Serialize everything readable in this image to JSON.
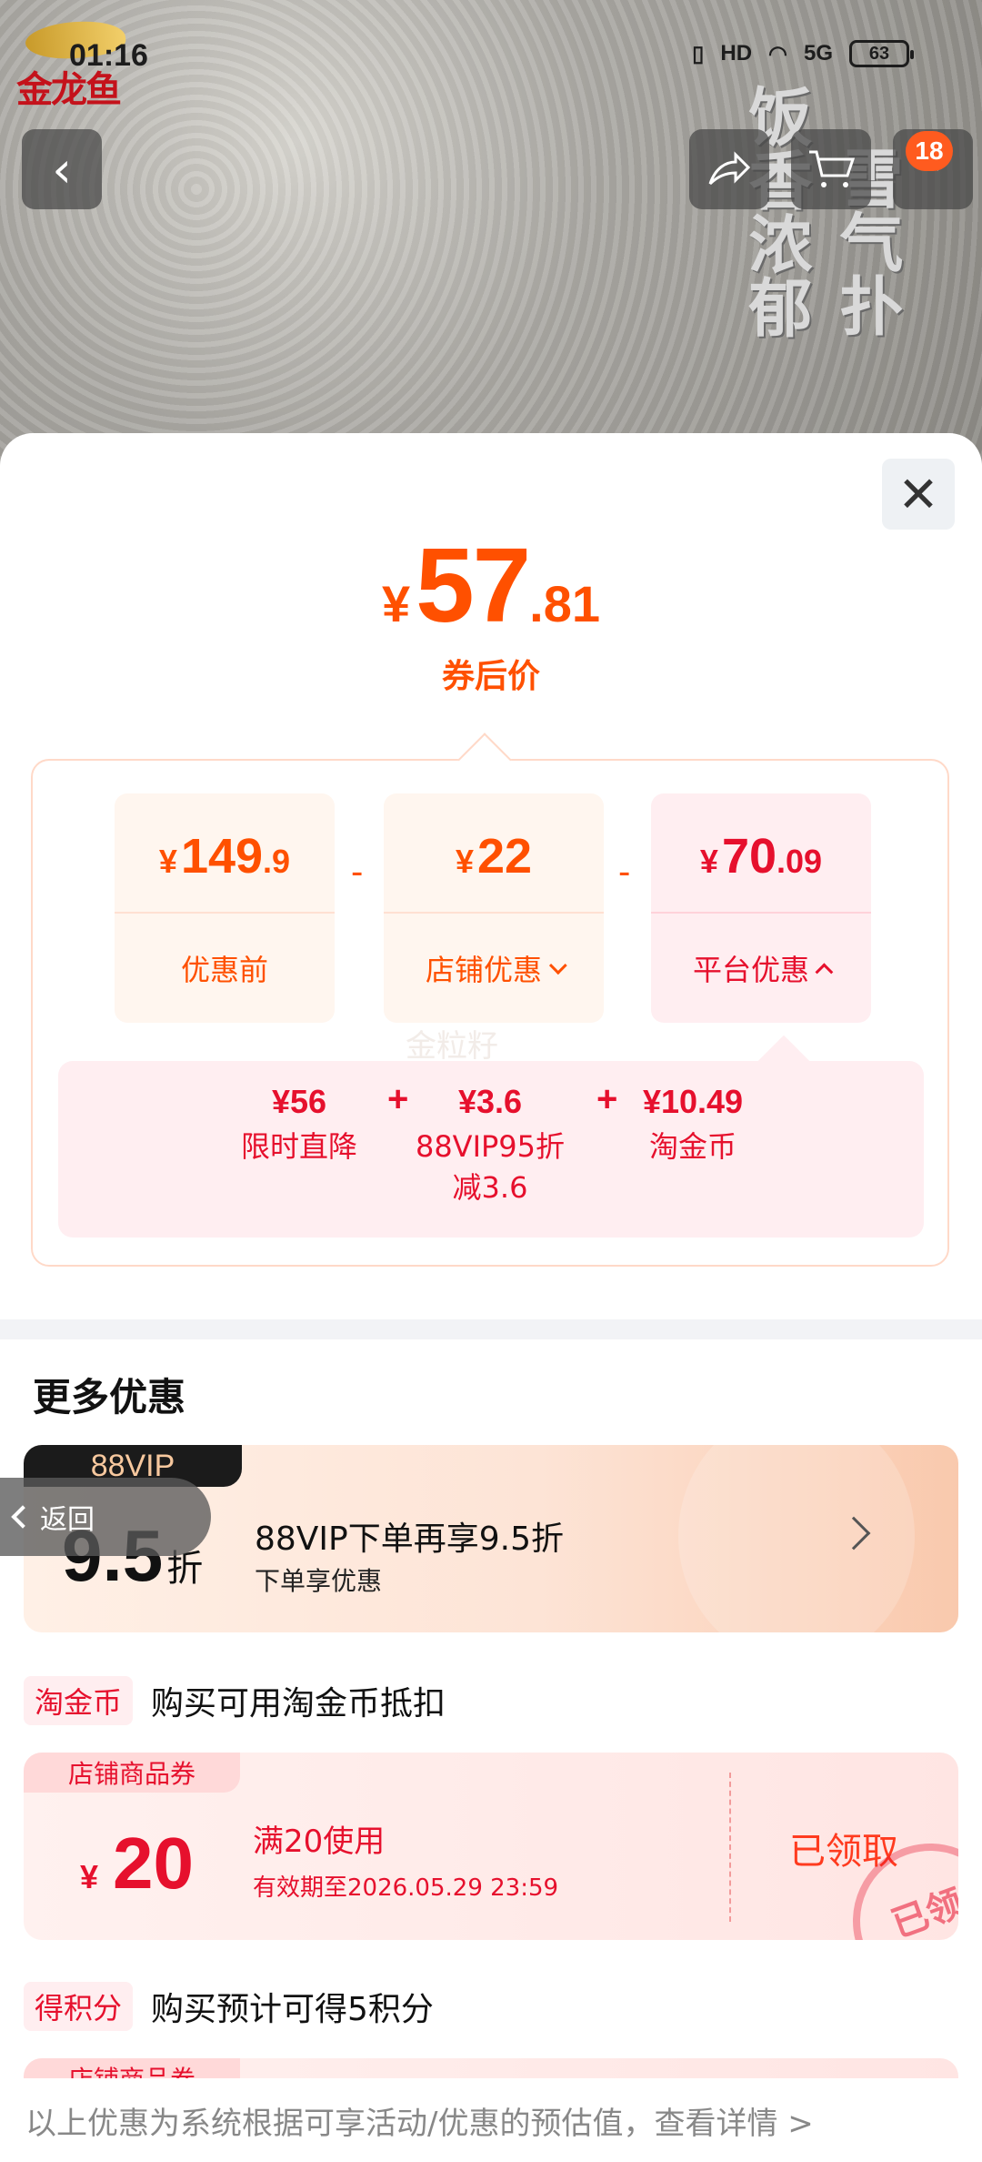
{
  "status_bar": {
    "time": "01:16",
    "hd": "HD",
    "network": "5G",
    "battery": "63"
  },
  "brand": {
    "name": "金龙鱼"
  },
  "background_slogans": {
    "left": "饭香浓郁",
    "right": "雪气扑"
  },
  "header": {
    "cart_badge": "18"
  },
  "sheet": {
    "final_price": {
      "currency": "¥",
      "integer": "57",
      "decimal": ".81",
      "label": "券后价"
    },
    "breakdown": [
      {
        "currency": "¥",
        "integer": "149",
        "decimal": ".9",
        "label": "优惠前"
      },
      {
        "currency": "¥",
        "integer": "22",
        "decimal": "",
        "label": "店铺优惠"
      },
      {
        "currency": "¥",
        "integer": "70",
        "decimal": ".09",
        "label": "平台优惠"
      }
    ],
    "operators": [
      "-",
      "-"
    ],
    "watermark": "金粒籽",
    "platform_details": [
      {
        "value": "¥56",
        "label": "限时直降"
      },
      {
        "value": "¥3.6",
        "label": "88VIP95折减3.6"
      },
      {
        "value": "¥10.49",
        "label": "淘金币"
      }
    ],
    "plus_ops": [
      "+",
      "+"
    ],
    "more_title": "更多优惠",
    "vip": {
      "tag": "88VIP",
      "discount_num": "9.5",
      "discount_unit": "折",
      "title": "88VIP下单再享9.5折",
      "subtitle": "下单享优惠"
    },
    "back_button": "返回",
    "coin_row": {
      "tag": "淘金币",
      "text": "购买可用淘金币抵扣"
    },
    "coupon": {
      "tag": "店铺商品券",
      "currency": "¥",
      "amount": "20",
      "condition": "满20使用",
      "expiry": "有效期至2026.05.29 23:59",
      "status": "已领取",
      "stamp": "已领"
    },
    "points_row": {
      "tag": "得积分",
      "text": "购买预计可得5积分"
    },
    "coupon2_tag": "店铺商品券",
    "footer": "以上优惠为系统根据可享活动/优惠的预估值，查看详情 >"
  }
}
